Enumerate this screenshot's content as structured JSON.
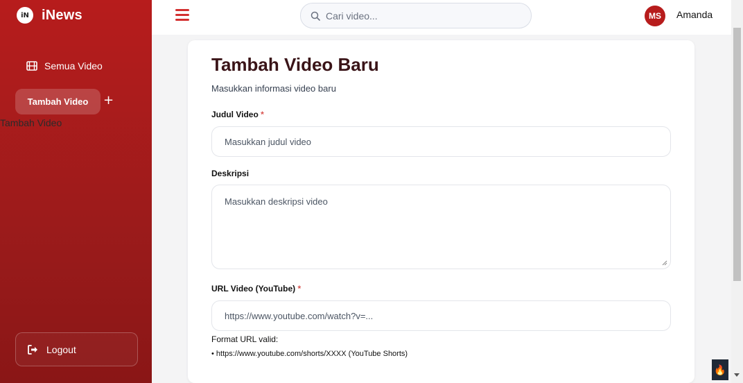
{
  "sidebar": {
    "brand_logo": "iN",
    "brand_name": "iNews",
    "nav": {
      "all_videos": "Semua Video",
      "add_video_button": "Tambah Video",
      "add_video_caption": "Tambah Video"
    },
    "logout": "Logout"
  },
  "header": {
    "search_placeholder": "Cari video...",
    "avatar_initials": "MS",
    "username": "Amanda"
  },
  "form": {
    "title": "Tambah Video Baru",
    "subtitle": "Masukkan informasi video baru",
    "title_field": {
      "label": "Judul Video",
      "required_mark": "*",
      "placeholder": "Masukkan judul video"
    },
    "description_field": {
      "label": "Deskripsi",
      "placeholder": "Masukkan deskripsi video"
    },
    "url_field": {
      "label": "URL Video (YouTube)",
      "required_mark": "*",
      "placeholder": "https://www.youtube.com/watch?v=..."
    },
    "url_hint_title": "Format URL valid:",
    "url_hint_item": "• https://www.youtube.com/shorts/XXXX (YouTube Shorts)"
  },
  "colors": {
    "sidebar_red": "#b71c1c",
    "accent_red": "#d32f2f",
    "title_color": "#3a1418"
  }
}
